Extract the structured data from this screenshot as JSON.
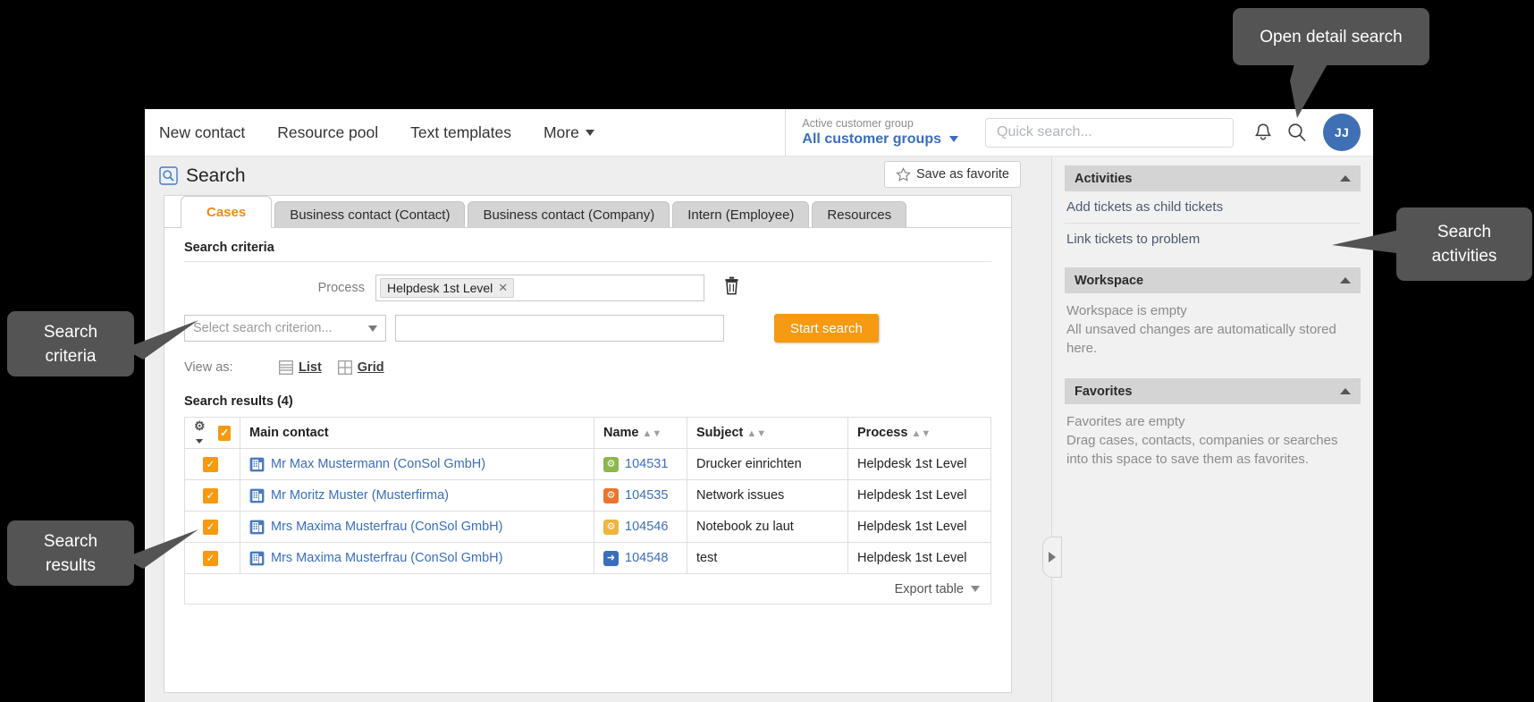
{
  "header": {
    "nav": [
      {
        "label": "New contact",
        "has_caret": false
      },
      {
        "label": "Resource pool",
        "has_caret": false
      },
      {
        "label": "Text templates",
        "has_caret": false
      },
      {
        "label": "More",
        "has_caret": true
      }
    ],
    "customer_group": {
      "label": "Active customer group",
      "value": "All customer groups"
    },
    "quick_search_placeholder": "Quick search...",
    "icons": {
      "bell": "bell-icon",
      "search": "search-icon"
    },
    "avatar_initials": "JJ"
  },
  "page": {
    "title": "Search",
    "save_favorite_label": "Save as favorite"
  },
  "tabs": [
    {
      "label": "Cases",
      "active": true
    },
    {
      "label": "Business contact (Contact)",
      "active": false
    },
    {
      "label": "Business contact (Company)",
      "active": false
    },
    {
      "label": "Intern (Employee)",
      "active": false
    },
    {
      "label": "Resources",
      "active": false
    }
  ],
  "search_criteria": {
    "section_title": "Search criteria",
    "process_label": "Process",
    "process_token": "Helpdesk 1st Level",
    "token_remove": "✕",
    "delete_icon": "trash-icon",
    "criterion_select_value": "Select search criterion...",
    "value_field_value": "",
    "start_search_label": "Start search"
  },
  "view_as": {
    "label": "View as:",
    "options": [
      {
        "label": "List",
        "icon": "list-view-icon",
        "active": true
      },
      {
        "label": "Grid",
        "icon": "grid-view-icon",
        "active": false
      }
    ]
  },
  "results": {
    "title": "Search results (4)",
    "columns": [
      "Main contact",
      "Name",
      "Subject",
      "Process"
    ],
    "header_checkbox_checked": true,
    "gear_menu_icon": "gear-dropdown-icon",
    "rows": [
      {
        "checked": true,
        "contact": "Mr Max Mustermann (ConSol GmbH)",
        "contact_icon": "company-contact-icon",
        "name": "104531",
        "name_icon": "case-gear-icon",
        "name_icon_color": "#8cb84b",
        "subject": "Drucker einrichten",
        "process": "Helpdesk 1st Level"
      },
      {
        "checked": true,
        "contact": "Mr Moritz Muster (Musterfirma)",
        "contact_icon": "company-contact-icon",
        "name": "104535",
        "name_icon": "case-gear-icon",
        "name_icon_color": "#e8762c",
        "subject": "Network issues",
        "process": "Helpdesk 1st Level"
      },
      {
        "checked": true,
        "contact": "Mrs Maxima Musterfrau (ConSol GmbH)",
        "contact_icon": "company-contact-icon",
        "name": "104546",
        "name_icon": "case-gear-icon",
        "name_icon_color": "#efb53f",
        "subject": "Notebook zu laut",
        "process": "Helpdesk 1st Level"
      },
      {
        "checked": true,
        "contact": "Mrs Maxima Musterfrau (ConSol GmbH)",
        "contact_icon": "company-contact-icon",
        "name": "104548",
        "name_icon": "case-arrow-icon",
        "name_icon_color": "#3a6ebd",
        "subject": "test",
        "process": "Helpdesk 1st Level"
      }
    ],
    "export_label": "Export table"
  },
  "sidebar": {
    "panels": [
      {
        "title": "Activities",
        "collapse_icon": "chevron-up-icon",
        "items": [
          "Add tickets as child tickets",
          "Link tickets to problem"
        ],
        "empty_text": ""
      },
      {
        "title": "Workspace",
        "collapse_icon": "chevron-up-icon",
        "items": [],
        "empty_text": "Workspace is empty\nAll unsaved changes are automatically stored here."
      },
      {
        "title": "Favorites",
        "collapse_icon": "chevron-up-icon",
        "items": [],
        "empty_text": "Favorites are empty\nDrag cases, contacts, companies or searches into this space to save them as favorites."
      }
    ],
    "collapse_handle_icon": "chevron-right-icon"
  },
  "annotations": [
    {
      "id": "detail",
      "text": "Open detail search"
    },
    {
      "id": "activities",
      "text": "Search\nactivities"
    },
    {
      "id": "criteria",
      "text": "Search\ncriteria"
    },
    {
      "id": "results",
      "text": "Search\nresults"
    }
  ],
  "colors": {
    "accent_orange": "#f59a11",
    "link_blue": "#3a6ebd",
    "tab_active_text": "#ef8b17",
    "callout_bg": "#555455",
    "avatar_bg": "#3f6fb5"
  }
}
